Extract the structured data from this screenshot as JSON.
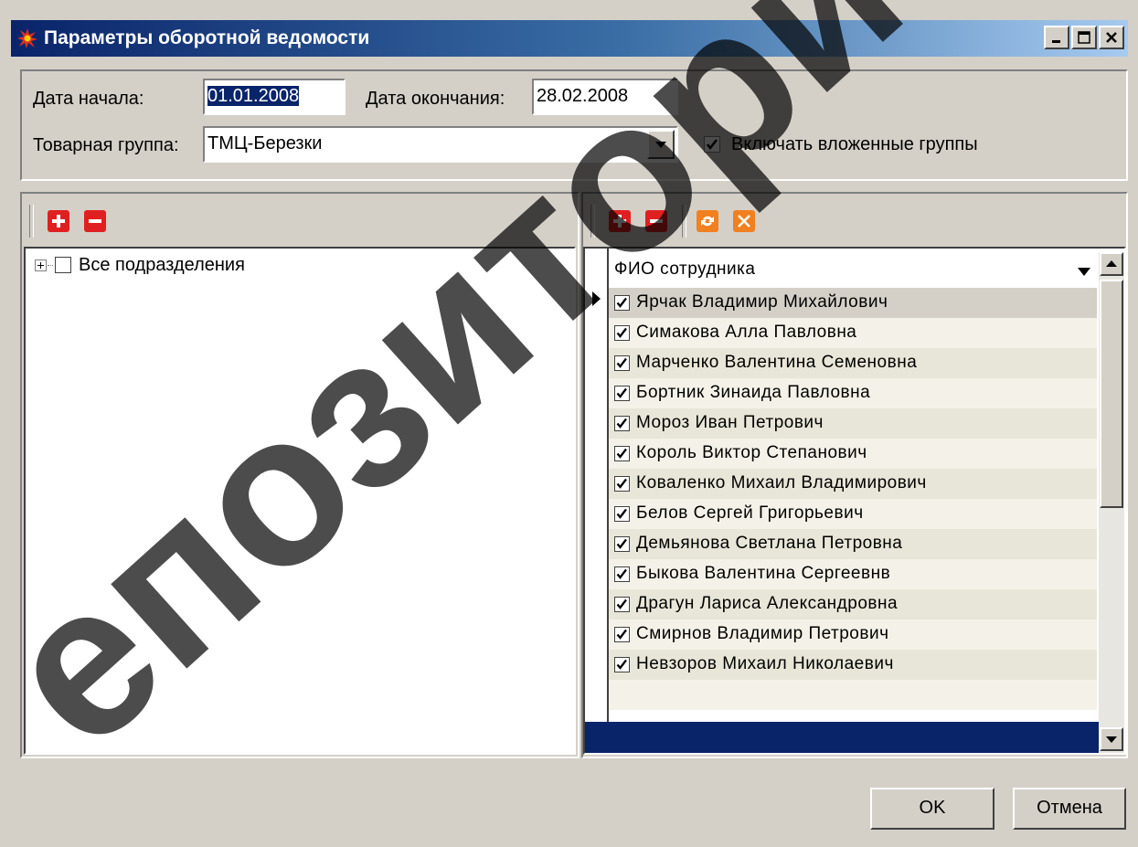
{
  "window": {
    "title": "Параметры оборотной ведомости"
  },
  "params": {
    "start_label": "Дата начала:",
    "start_value": "01.01.2008",
    "end_label": "Дата окончания:",
    "end_value": "28.02.2008",
    "group_label": "Товарная группа:",
    "group_value": "ТМЦ-Березки",
    "include_nested_label": "Включать вложенные группы",
    "include_nested_checked": true
  },
  "departments": {
    "tree_root_label": "Все подразделения",
    "tree_root_checked": false
  },
  "employees": {
    "column_header": "ФИО сотрудника",
    "rows": [
      {
        "name": "Ярчак Владимир Михайлович",
        "checked": true
      },
      {
        "name": "Симакова Алла Павловна",
        "checked": true
      },
      {
        "name": "Марченко Валентина Семеновна",
        "checked": true
      },
      {
        "name": "Бортник Зинаида Павловна",
        "checked": true
      },
      {
        "name": "Мороз Иван Петрович",
        "checked": true
      },
      {
        "name": "Король Виктор Степанович",
        "checked": true
      },
      {
        "name": "Коваленко Михаил Владимирович",
        "checked": true
      },
      {
        "name": "Белов Сергей Григорьевич",
        "checked": true
      },
      {
        "name": "Демьянова Светлана Петровна",
        "checked": true
      },
      {
        "name": "Быкова Валентина Сергеевнв",
        "checked": true
      },
      {
        "name": "Драгун Лариса Александровна",
        "checked": true
      },
      {
        "name": "Смирнов Владимир Петрович",
        "checked": true
      },
      {
        "name": "Невзоров Михаил Николаевич",
        "checked": true
      }
    ]
  },
  "buttons": {
    "ok": "OK",
    "cancel": "Отмена"
  },
  "watermark": "епозитори",
  "colors": {
    "title_start": "#0a246a",
    "title_end": "#a6caf0",
    "row_odd": "#f4f2e8",
    "row_even": "#e8e6d8",
    "row_selected": "#d4d0c8",
    "footer_bar": "#0a246a",
    "add_button": "#e02020",
    "refresh_button": "#f08020"
  }
}
